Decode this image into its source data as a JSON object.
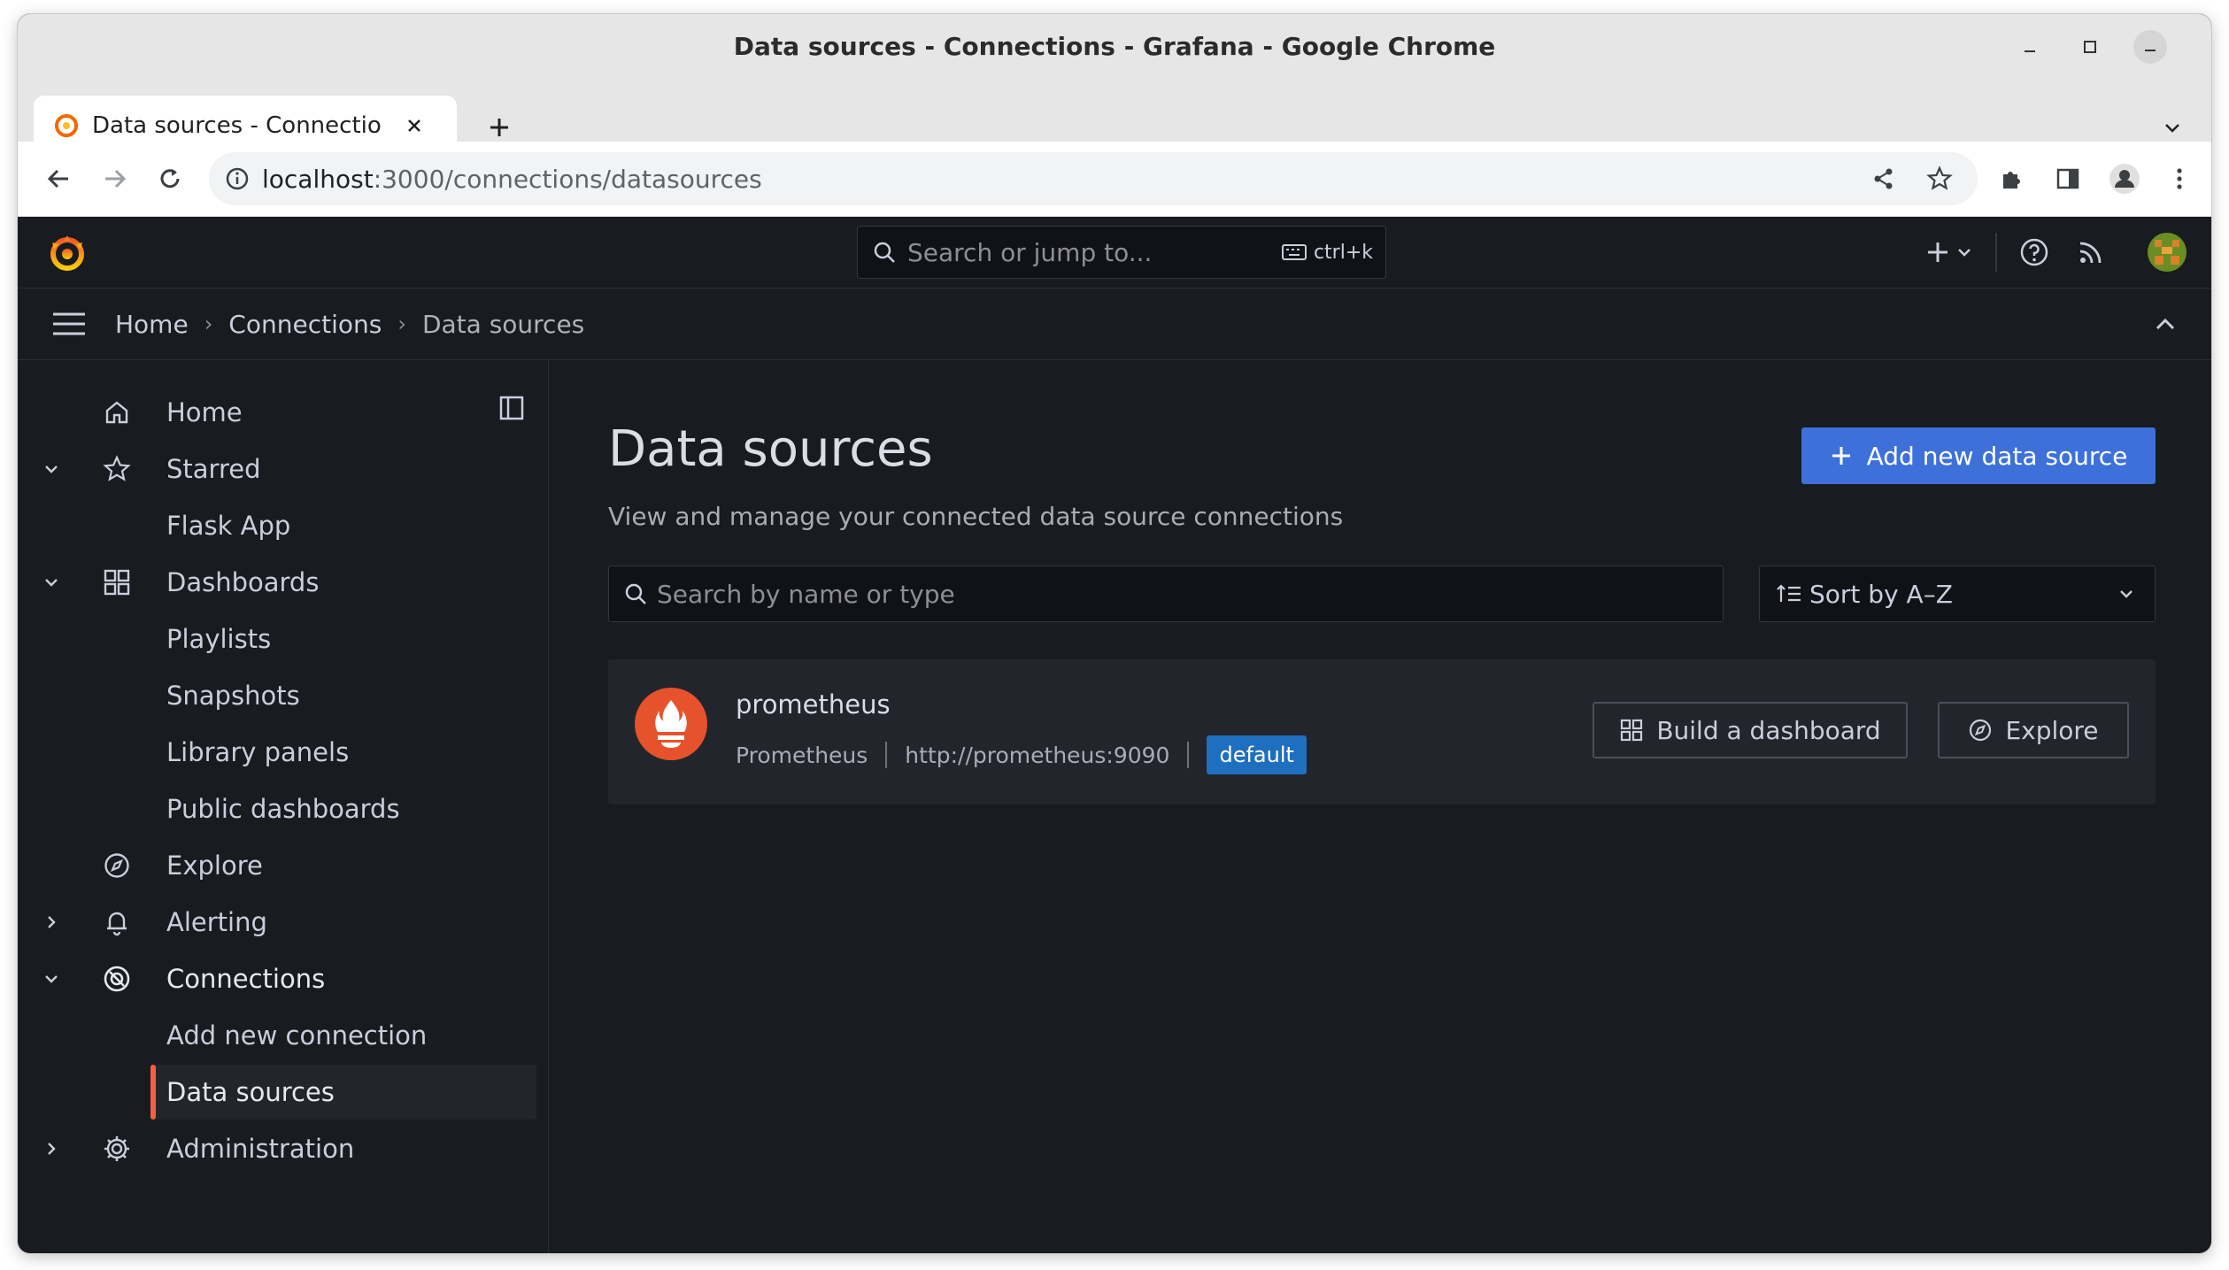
{
  "window": {
    "title": "Data sources - Connections - Grafana - Google Chrome"
  },
  "tab": {
    "title": "Data sources - Connectio"
  },
  "omnibox": {
    "host": "localhost",
    "path": ":3000/connections/datasources"
  },
  "topbar": {
    "search_placeholder": "Search or jump to...",
    "shortcut": "ctrl+k"
  },
  "breadcrumb": [
    "Home",
    "Connections",
    "Data sources"
  ],
  "sidebar": {
    "items": [
      {
        "label": "Home"
      },
      {
        "label": "Starred"
      },
      {
        "label": "Flask App"
      },
      {
        "label": "Dashboards"
      },
      {
        "label": "Playlists"
      },
      {
        "label": "Snapshots"
      },
      {
        "label": "Library panels"
      },
      {
        "label": "Public dashboards"
      },
      {
        "label": "Explore"
      },
      {
        "label": "Alerting"
      },
      {
        "label": "Connections"
      },
      {
        "label": "Add new connection"
      },
      {
        "label": "Data sources"
      },
      {
        "label": "Administration"
      }
    ]
  },
  "page": {
    "title": "Data sources",
    "subtitle": "View and manage your connected data source connections",
    "add_button": "Add new data source",
    "search_placeholder": "Search by name or type",
    "sort_label": "Sort by A–Z"
  },
  "datasources": [
    {
      "name": "prometheus",
      "type": "Prometheus",
      "url": "http://prometheus:9090",
      "badge": "default",
      "build_button": "Build a dashboard",
      "explore_button": "Explore"
    }
  ],
  "colors": {
    "grafana_bg": "#181b1f",
    "accent": "#f55f3e",
    "primary": "#3d71d9",
    "badge": "#1f6fbf"
  }
}
